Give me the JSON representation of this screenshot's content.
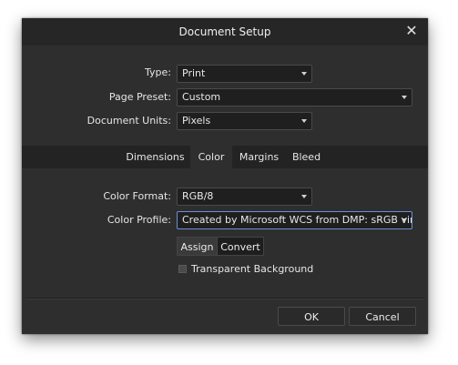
{
  "window": {
    "title": "Document Setup",
    "close_glyph": "✕"
  },
  "setup": {
    "type_label": "Type:",
    "type_value": "Print",
    "preset_label": "Page Preset:",
    "preset_value": "Custom",
    "units_label": "Document Units:",
    "units_value": "Pixels"
  },
  "tabs": [
    {
      "label": "Dimensions",
      "active": false
    },
    {
      "label": "Color",
      "active": true
    },
    {
      "label": "Margins",
      "active": false
    },
    {
      "label": "Bleed",
      "active": false
    }
  ],
  "color": {
    "format_label": "Color Format:",
    "format_value": "RGB/8",
    "profile_label": "Color Profile:",
    "profile_value": "Created by Microsoft WCS from DMP: sRGB virtual",
    "assign_label": "Assign",
    "convert_label": "Convert",
    "transparent_label": "Transparent Background",
    "transparent_checked": false
  },
  "footer": {
    "ok_label": "OK",
    "cancel_label": "Cancel"
  },
  "colors": {
    "dialog_bg": "#2e2e2e",
    "titlebar_bg": "#262626",
    "field_bg": "#1f1f1f",
    "focus_border": "#6a8fd6"
  }
}
